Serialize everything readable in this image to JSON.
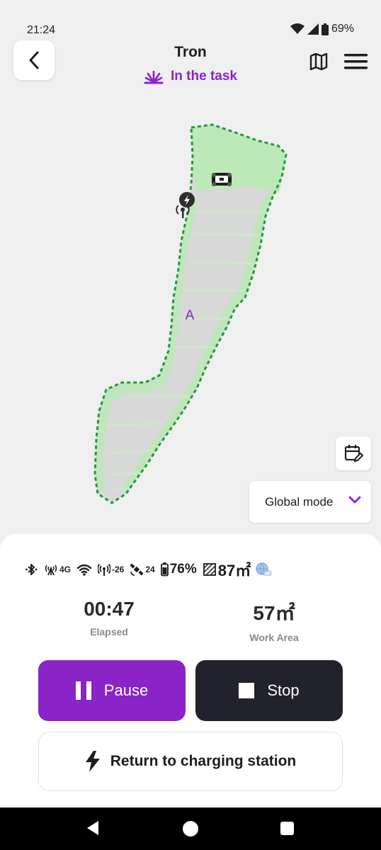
{
  "status_bar": {
    "time": "21:24",
    "battery": "69%",
    "icons": [
      "wifi-icon",
      "cell-signal-icon",
      "battery-icon"
    ]
  },
  "header": {
    "back_icon": "chevron-left-icon",
    "title": "Tron",
    "status": "In the task",
    "status_color": "#8a24c6",
    "actions": [
      "map-icon",
      "menu-icon"
    ]
  },
  "map": {
    "zone_label": "A",
    "boundary_color": "#1f9a3a",
    "mowed_color": "#bde8b8",
    "unmowed_color": "#d8d8d8"
  },
  "controls": {
    "mode_label": "Global mode"
  },
  "panel": {
    "stats": {
      "cell": "4G",
      "rtk_signal": "-26",
      "satellites": "24",
      "battery": "76%",
      "area": "87㎡"
    },
    "elapsed_value": "00:47",
    "elapsed_label": "Elapsed",
    "work_area_value": "57㎡",
    "work_area_label": "Work Area",
    "pause_label": "Pause",
    "stop_label": "Stop",
    "return_label": "Return to charging station"
  },
  "accent_color": "#8a24c6",
  "dark_color": "#22222c"
}
